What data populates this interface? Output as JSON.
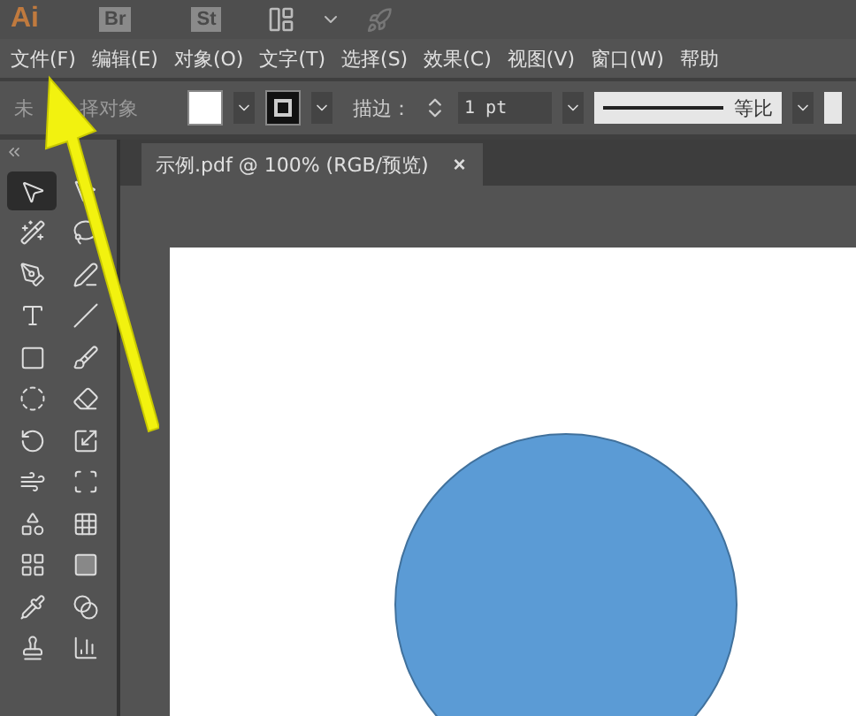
{
  "app_bar": {
    "logo": "Ai",
    "bridge": "Br",
    "stock": "St"
  },
  "menu": [
    "文件(F)",
    "编辑(E)",
    "对象(O)",
    "文字(T)",
    "选择(S)",
    "效果(C)",
    "视图(V)",
    "窗口(W)",
    "帮助"
  ],
  "control_bar": {
    "selection": [
      "未",
      "择对象"
    ],
    "stroke_label": "描边：",
    "stroke_value": "1 pt",
    "profile": "等比"
  },
  "tab": {
    "title": "示例.pdf @ 100% (RGB/预览)",
    "close": "×"
  },
  "tools": [
    {
      "kind": "selection",
      "selected": true
    },
    {
      "kind": "direct",
      "selected": false
    },
    {
      "kind": "wand",
      "selected": false
    },
    {
      "kind": "lasso",
      "selected": false
    },
    {
      "kind": "pen",
      "selected": false
    },
    {
      "kind": "curvature",
      "selected": false
    },
    {
      "kind": "type",
      "selected": false
    },
    {
      "kind": "line",
      "selected": false
    },
    {
      "kind": "rect",
      "selected": false
    },
    {
      "kind": "brush",
      "selected": false
    },
    {
      "kind": "shaper",
      "selected": false
    },
    {
      "kind": "eraser",
      "selected": false
    },
    {
      "kind": "rotate",
      "selected": false
    },
    {
      "kind": "scale",
      "selected": false
    },
    {
      "kind": "warp",
      "selected": false
    },
    {
      "kind": "freetransform",
      "selected": false
    },
    {
      "kind": "shapebuilder",
      "selected": false
    },
    {
      "kind": "perspective",
      "selected": false
    },
    {
      "kind": "mesh",
      "selected": false
    },
    {
      "kind": "gradient",
      "selected": false
    },
    {
      "kind": "eyedropper",
      "selected": false
    },
    {
      "kind": "blend",
      "selected": false
    },
    {
      "kind": "symbol",
      "selected": false
    },
    {
      "kind": "graph",
      "selected": false
    }
  ]
}
